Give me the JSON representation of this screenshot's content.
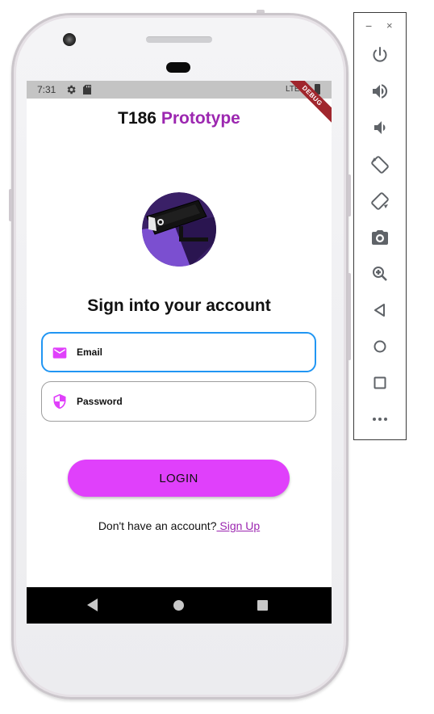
{
  "status_bar": {
    "time": "7:31",
    "network": "LTE",
    "debug_label": "DEBUG"
  },
  "app": {
    "title_main": "T186",
    "title_accent": "Prototype",
    "heading": "Sign into your account",
    "email_placeholder": "Email",
    "password_placeholder": "Password",
    "login_label": "LOGIN",
    "signup_prompt": "Don't have an account?",
    "signup_link": " Sign Up"
  },
  "colors": {
    "accent_purple": "#9c27b0",
    "button_magenta": "#e040fb",
    "focus_blue": "#2196f3",
    "icon_magenta": "#e040fb"
  },
  "emulator_toolbar": {
    "minimize_label": "−",
    "close_label": "×",
    "buttons": [
      "power-icon",
      "volume-up-icon",
      "volume-down-icon",
      "rotate-left-icon",
      "rotate-right-icon",
      "camera-icon",
      "zoom-icon",
      "back-icon",
      "home-icon",
      "overview-icon",
      "more-icon"
    ]
  }
}
